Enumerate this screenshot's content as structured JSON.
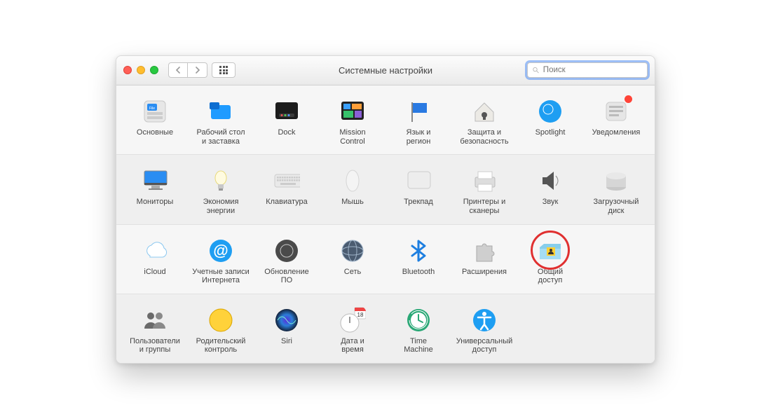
{
  "window": {
    "title": "Системные настройки"
  },
  "search": {
    "placeholder": "Поиск"
  },
  "rows": [
    [
      {
        "id": "general",
        "label": "Основные",
        "icon": "general"
      },
      {
        "id": "desktop",
        "label": "Рабочий стол\nи заставка",
        "icon": "desktop"
      },
      {
        "id": "dock",
        "label": "Dock",
        "icon": "dock"
      },
      {
        "id": "mission",
        "label": "Mission\nControl",
        "icon": "mission"
      },
      {
        "id": "language",
        "label": "Язык и\nрегион",
        "icon": "flag"
      },
      {
        "id": "security",
        "label": "Защита и\nбезопасность",
        "icon": "house"
      },
      {
        "id": "spotlight",
        "label": "Spotlight",
        "icon": "spotlight"
      },
      {
        "id": "notifications",
        "label": "Уведомления",
        "icon": "notif",
        "badge": true
      }
    ],
    [
      {
        "id": "displays",
        "label": "Мониторы",
        "icon": "display"
      },
      {
        "id": "energy",
        "label": "Экономия\nэнергии",
        "icon": "bulb"
      },
      {
        "id": "keyboard",
        "label": "Клавиатура",
        "icon": "keyboard"
      },
      {
        "id": "mouse",
        "label": "Мышь",
        "icon": "mouse"
      },
      {
        "id": "trackpad",
        "label": "Трекпад",
        "icon": "trackpad"
      },
      {
        "id": "printers",
        "label": "Принтеры и\nсканеры",
        "icon": "printer"
      },
      {
        "id": "sound",
        "label": "Звук",
        "icon": "speaker"
      },
      {
        "id": "startup",
        "label": "Загрузочный\nдиск",
        "icon": "disk"
      }
    ],
    [
      {
        "id": "icloud",
        "label": "iCloud",
        "icon": "icloud"
      },
      {
        "id": "accounts",
        "label": "Учетные записи\nИнтернета",
        "icon": "at"
      },
      {
        "id": "update",
        "label": "Обновление\nПО",
        "icon": "gear"
      },
      {
        "id": "network",
        "label": "Сеть",
        "icon": "globe"
      },
      {
        "id": "bluetooth",
        "label": "Bluetooth",
        "icon": "bt"
      },
      {
        "id": "extensions",
        "label": "Расширения",
        "icon": "puzzle"
      },
      {
        "id": "sharing",
        "label": "Общий\nдоступ",
        "icon": "sharing",
        "highlight": true
      },
      {
        "id": "empty1",
        "label": "",
        "icon": "",
        "empty": true
      }
    ],
    [
      {
        "id": "users",
        "label": "Пользователи\nи группы",
        "icon": "users"
      },
      {
        "id": "parental",
        "label": "Родительский\nконтроль",
        "icon": "parental"
      },
      {
        "id": "siri",
        "label": "Siri",
        "icon": "siri"
      },
      {
        "id": "datetime",
        "label": "Дата и\nвремя",
        "icon": "clock"
      },
      {
        "id": "timemachine",
        "label": "Time\nMachine",
        "icon": "timemachine"
      },
      {
        "id": "accessibility",
        "label": "Универсальный\nдоступ",
        "icon": "access"
      },
      {
        "id": "empty2",
        "label": "",
        "icon": "",
        "empty": true
      },
      {
        "id": "empty3",
        "label": "",
        "icon": "",
        "empty": true
      }
    ]
  ]
}
